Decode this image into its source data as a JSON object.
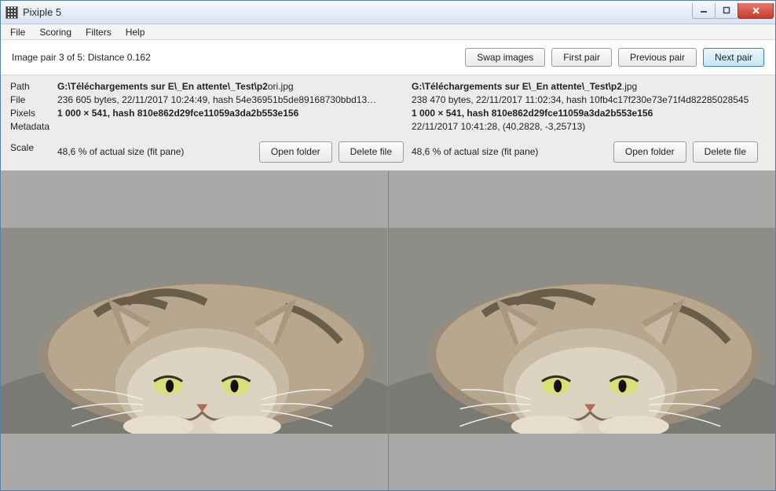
{
  "window": {
    "title": "Pixiple 5"
  },
  "menu": {
    "file": "File",
    "scoring": "Scoring",
    "filters": "Filters",
    "help": "Help"
  },
  "toolbar": {
    "status": "Image pair 3 of 5: Distance 0.162",
    "swap": "Swap images",
    "first": "First pair",
    "prev": "Previous pair",
    "next": "Next pair"
  },
  "labels": {
    "path": "Path",
    "file": "File",
    "pixels": "Pixels",
    "metadata": "Metadata",
    "scale": "Scale"
  },
  "left": {
    "path_prefix": "G:\\Téléchargements sur E\\_En attente\\_Test\\p2",
    "path_suffix": "ori.jpg",
    "file": "236 605 bytes, 22/11/2017 10:24:49, hash 54e36951b5de89168730bbd13…",
    "pixels": "1 000 × 541, hash 810e862d29fce11059a3da2b553e156",
    "metadata": "",
    "scale": "48,6 % of actual size (fit pane)",
    "open_folder": "Open folder",
    "delete_file": "Delete file"
  },
  "right": {
    "path_prefix": "G:\\Téléchargements sur E\\_En attente\\_Test\\p2",
    "path_suffix": ".jpg",
    "file": "238 470 bytes, 22/11/2017 11:02:34, hash 10fb4c17f230e73e71f4d82285028545",
    "pixels": "1 000 × 541, hash 810e862d29fce11059a3da2b553e156",
    "metadata": "22/11/2017 10:41:28, (40,2828, -3,25713)",
    "scale": "48,6 % of actual size (fit pane)",
    "open_folder": "Open folder",
    "delete_file": "Delete file"
  }
}
